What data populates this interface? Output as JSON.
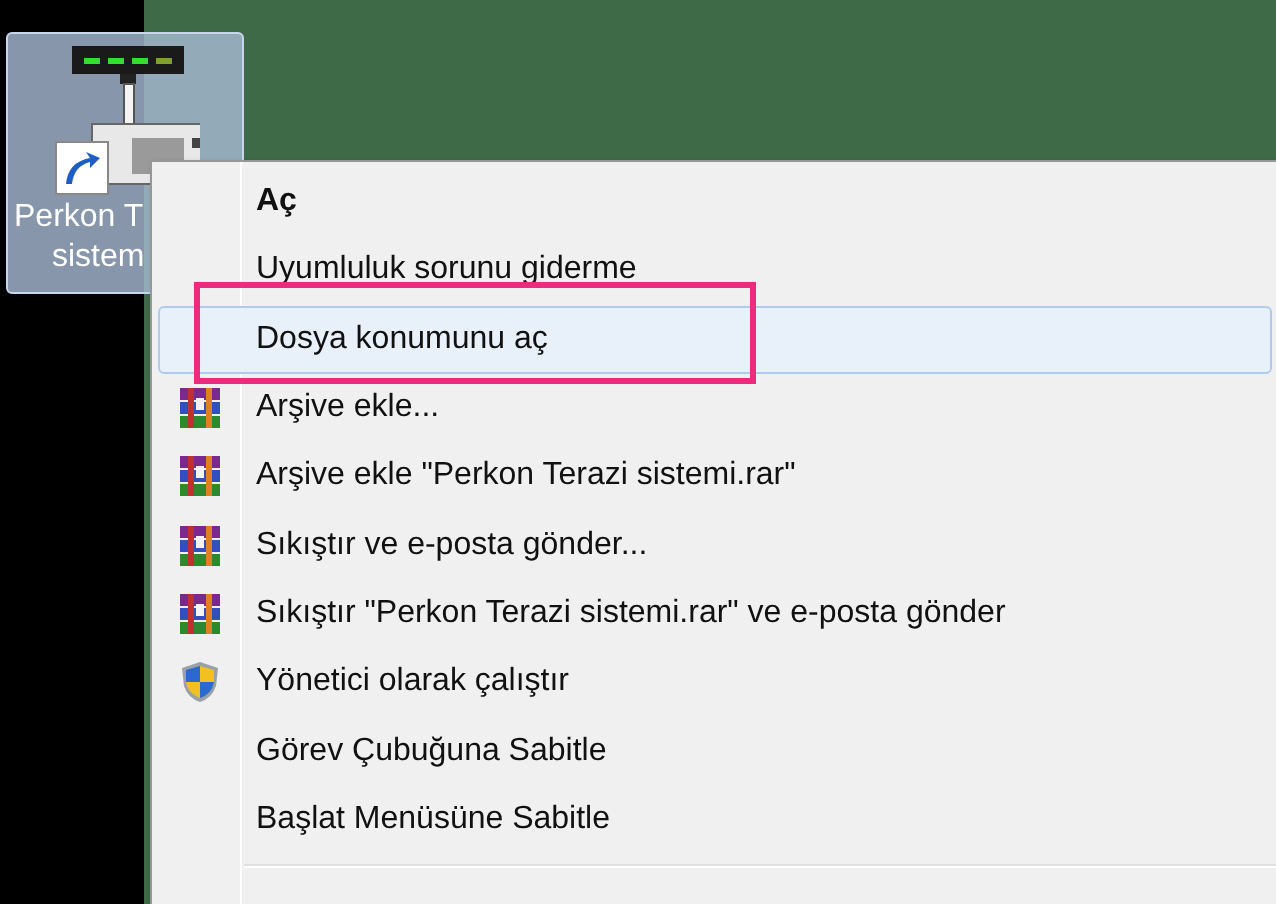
{
  "desktop_icon": {
    "label_lines": [
      "Perkon T",
      "sistem"
    ],
    "selected": true
  },
  "context_menu": {
    "items": [
      {
        "label": "Aç",
        "kind": "plain",
        "default": true,
        "highlighted": false,
        "annotated": false
      },
      {
        "label": "Uyumluluk sorunu giderme",
        "kind": "plain",
        "default": false,
        "highlighted": false,
        "annotated": false
      },
      {
        "label": "Dosya konumunu aç",
        "kind": "plain",
        "default": false,
        "highlighted": true,
        "annotated": true
      },
      {
        "label": "Arşive ekle...",
        "kind": "archive",
        "default": false,
        "highlighted": false,
        "annotated": false
      },
      {
        "label": "Arşive ekle \"Perkon Terazi sistemi.rar\"",
        "kind": "archive",
        "default": false,
        "highlighted": false,
        "annotated": false
      },
      {
        "label": "Sıkıştır ve e-posta gönder...",
        "kind": "archive",
        "default": false,
        "highlighted": false,
        "annotated": false
      },
      {
        "label": "Sıkıştır \"Perkon Terazi sistemi.rar\" ve e-posta gönder",
        "kind": "archive",
        "default": false,
        "highlighted": false,
        "annotated": false
      },
      {
        "label": "Yönetici olarak çalıştır",
        "kind": "shield",
        "default": false,
        "highlighted": false,
        "annotated": false
      },
      {
        "label": "Görev Çubuğuna Sabitle",
        "kind": "plain",
        "default": false,
        "highlighted": false,
        "annotated": false
      },
      {
        "label": "Başlat Menüsüne Sabitle",
        "kind": "plain",
        "default": false,
        "highlighted": false,
        "annotated": false
      },
      {
        "kind": "separator"
      }
    ]
  }
}
